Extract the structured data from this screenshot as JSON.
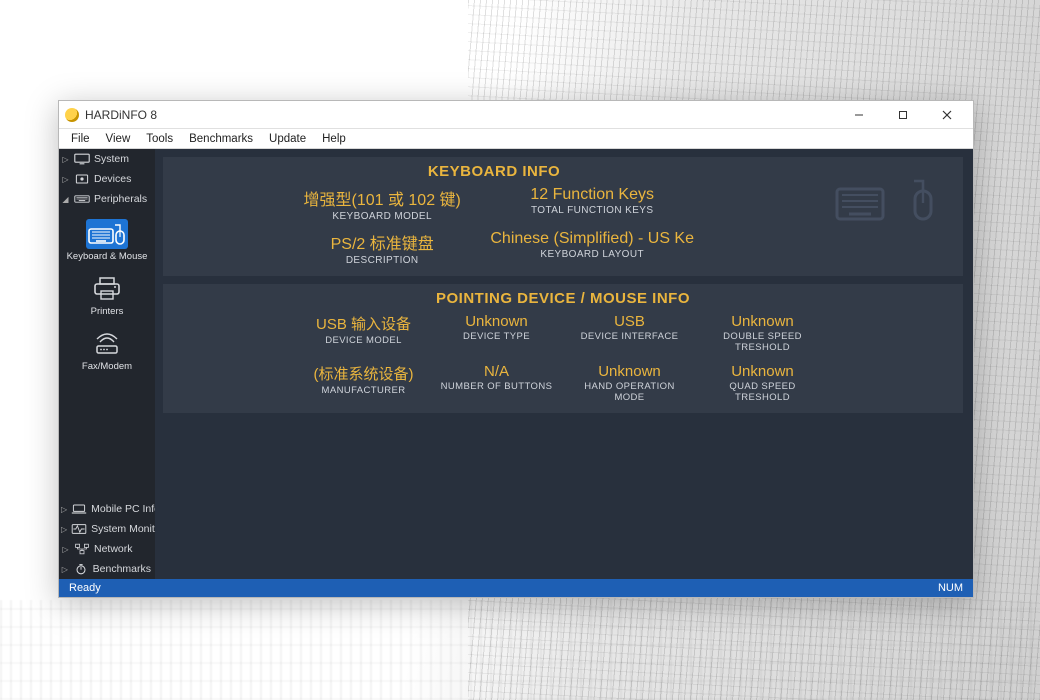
{
  "app": {
    "title": "HARDiNFO 8"
  },
  "menu": [
    "File",
    "View",
    "Tools",
    "Benchmarks",
    "Update",
    "Help"
  ],
  "sidebar": {
    "top": [
      {
        "label": "System",
        "chev": "▷"
      },
      {
        "label": "Devices",
        "chev": "▷"
      },
      {
        "label": "Peripherals",
        "chev": "◢"
      }
    ],
    "peripherals": [
      {
        "label": "Keyboard & Mouse"
      },
      {
        "label": "Printers"
      },
      {
        "label": "Fax/Modem"
      }
    ],
    "bottom": [
      {
        "label": "Mobile PC Info",
        "chev": "▷"
      },
      {
        "label": "System Monitor",
        "chev": "▷"
      },
      {
        "label": "Network",
        "chev": "▷"
      },
      {
        "label": "Benchmarks",
        "chev": "▷"
      }
    ]
  },
  "keyboard": {
    "title": "KEYBOARD INFO",
    "cells": [
      {
        "val": "增强型(101 或 102 键)",
        "lab": "KEYBOARD MODEL"
      },
      {
        "val": "12 Function Keys",
        "lab": "TOTAL FUNCTION KEYS"
      },
      {
        "val": "PS/2 标准键盘",
        "lab": "DESCRIPTION"
      },
      {
        "val": "Chinese (Simplified) - US Ke",
        "lab": "KEYBOARD LAYOUT"
      }
    ]
  },
  "mouse": {
    "title": "POINTING DEVICE / MOUSE INFO",
    "cells": [
      {
        "val": "USB 输入设备",
        "lab": "DEVICE MODEL"
      },
      {
        "val": "Unknown",
        "lab": "DEVICE TYPE"
      },
      {
        "val": "USB",
        "lab": "DEVICE INTERFACE"
      },
      {
        "val": "Unknown",
        "lab": "DOUBLE SPEED TRESHOLD"
      },
      {
        "val": "(标准系统设备)",
        "lab": "MANUFACTURER"
      },
      {
        "val": "N/A",
        "lab": "NUMBER OF BUTTONS"
      },
      {
        "val": "Unknown",
        "lab": "HAND OPERATION MODE"
      },
      {
        "val": "Unknown",
        "lab": "QUAD SPEED TRESHOLD"
      }
    ]
  },
  "status": {
    "left": "Ready",
    "right": "NUM"
  }
}
